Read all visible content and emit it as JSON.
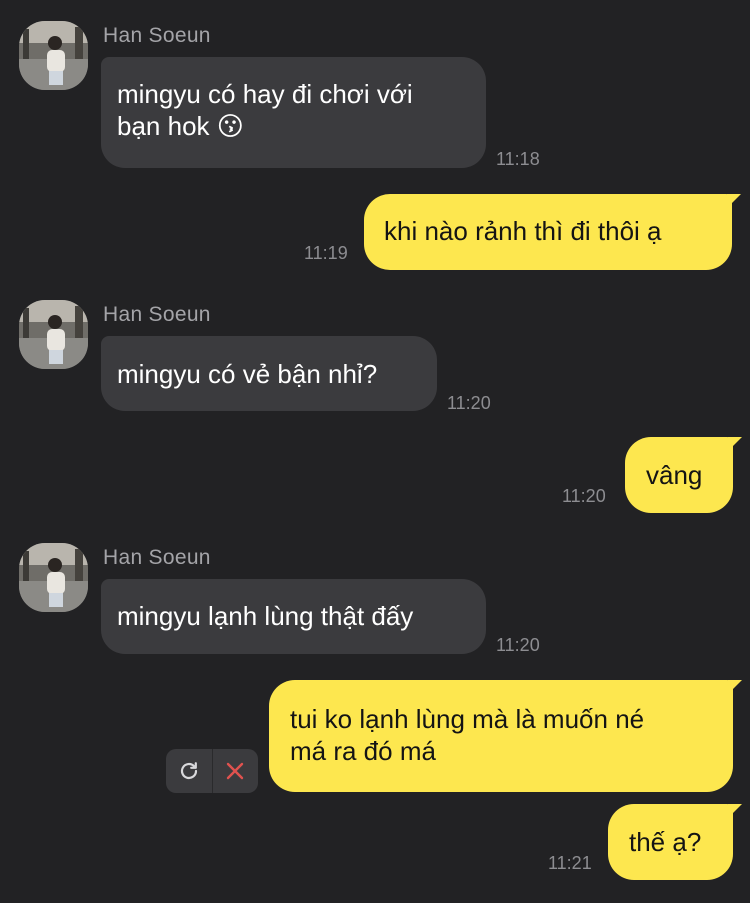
{
  "colors": {
    "background": "#222224",
    "incoming_bubble": "#3b3b3e",
    "outgoing_bubble": "#fde74f",
    "timestamp": "#8d8d91",
    "sender_name": "#a4a4a8",
    "cancel_red": "#e0524f"
  },
  "messages": [
    {
      "direction": "incoming",
      "sender": "Han Soeun",
      "text": "mingyu có hay đi chơi với\nbạn hok",
      "emoji": "😗",
      "time": "11:18"
    },
    {
      "direction": "outgoing",
      "text": "khi nào rảnh thì đi thôi ạ",
      "time": "11:19"
    },
    {
      "direction": "incoming",
      "sender": "Han Soeun",
      "text": "mingyu có vẻ bận nhỉ?",
      "time": "11:20"
    },
    {
      "direction": "outgoing",
      "text": "vâng",
      "time": "11:20"
    },
    {
      "direction": "incoming",
      "sender": "Han Soeun",
      "text": "mingyu lạnh lùng thật đấy",
      "time": "11:20"
    },
    {
      "direction": "outgoing",
      "text": "tui ko lạnh lùng mà là muốn né\nmá ra đó má",
      "status": "failed",
      "actions": [
        "retry-icon",
        "cancel-icon"
      ]
    },
    {
      "direction": "outgoing",
      "text": "thế ạ?",
      "time": "11:21"
    }
  ]
}
